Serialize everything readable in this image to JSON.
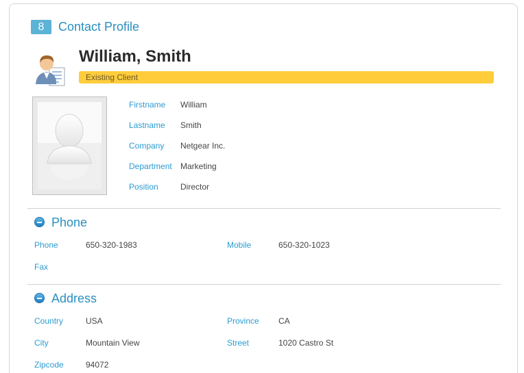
{
  "header": {
    "badge": "8",
    "title": "Contact Profile"
  },
  "contact": {
    "name": "William, Smith",
    "status": "Existing Client",
    "fields": [
      {
        "label": "Firstname",
        "value": "William"
      },
      {
        "label": "Lastname",
        "value": "Smith"
      },
      {
        "label": "Company",
        "value": "Netgear Inc."
      },
      {
        "label": "Department",
        "value": "Marketing"
      },
      {
        "label": "Position",
        "value": "Director"
      }
    ]
  },
  "phone": {
    "title": "Phone",
    "phone": {
      "label": "Phone",
      "value": "650-320-1983"
    },
    "mobile": {
      "label": "Mobile",
      "value": "650-320-1023"
    },
    "fax": {
      "label": "Fax",
      "value": ""
    }
  },
  "address": {
    "title": "Address",
    "country": {
      "label": "Country",
      "value": "USA"
    },
    "province": {
      "label": "Province",
      "value": "CA"
    },
    "city": {
      "label": "City",
      "value": "Mountain View"
    },
    "street": {
      "label": "Street",
      "value": "1020 Castro St"
    },
    "zipcode": {
      "label": "Zipcode",
      "value": "94072"
    }
  },
  "colors": {
    "accent": "#2a9bd0",
    "status": "#ffcd3c",
    "badge": "#5bb3d6"
  }
}
